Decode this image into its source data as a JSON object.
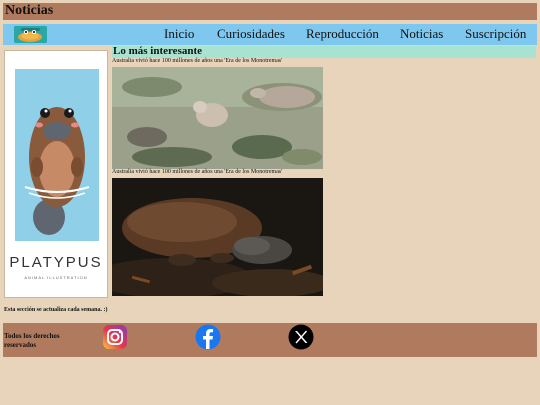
{
  "header": {
    "title": "Noticias"
  },
  "nav": {
    "items": [
      {
        "label": "Inicio"
      },
      {
        "label": "Curiosidades"
      },
      {
        "label": "Reproducción"
      },
      {
        "label": "Noticias"
      },
      {
        "label": "Suscripción"
      }
    ]
  },
  "sidebar_image": {
    "brand": "PLATYPUS",
    "subtitle": "ANIMAL ILLUSTRATION"
  },
  "main": {
    "heading": "Lo más interesante",
    "articles": [
      {
        "caption": "Australia vivió hace 100 millones de años una 'Era de los Monotremas'"
      },
      {
        "caption": "Australia vivió hace 100 millones de años una 'Era de los Monotremas'"
      }
    ],
    "update_note": "Esta sección se actualiza cada semana. :)"
  },
  "footer": {
    "copyright": "Todos los derechos reservados",
    "social": [
      {
        "icon": "instagram-icon"
      },
      {
        "icon": "facebook-icon"
      },
      {
        "icon": "x-icon"
      }
    ]
  },
  "colors": {
    "background": "#e8d4bb",
    "header": "#b07a5e",
    "nav": "#7ec8f0",
    "section_head": "#a8e3d2"
  }
}
